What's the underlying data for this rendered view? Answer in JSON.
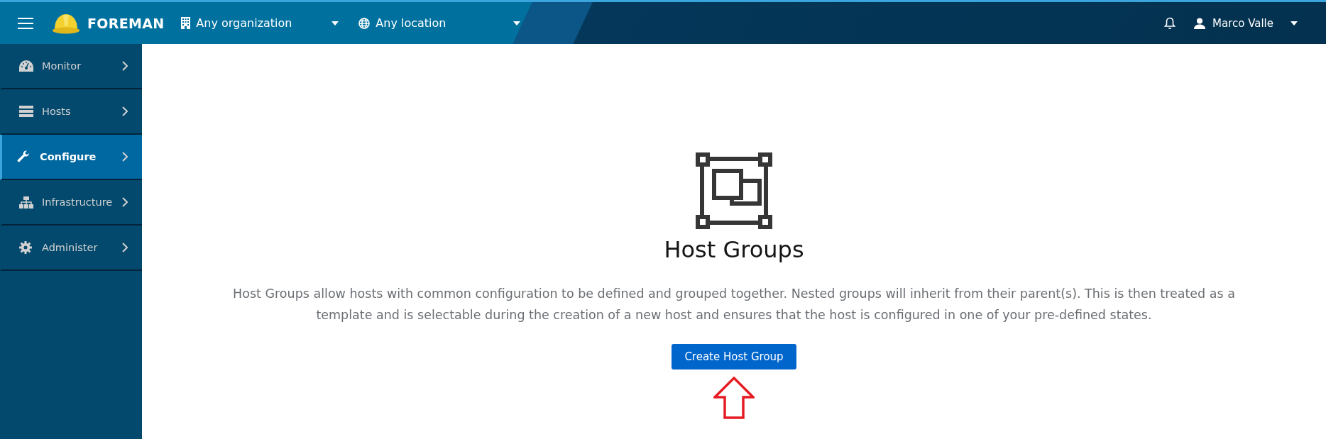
{
  "header": {
    "brand": "FOREMAN",
    "organization": "Any organization",
    "location": "Any location",
    "user": "Marco Valle"
  },
  "sidebar": {
    "items": [
      {
        "label": "Monitor",
        "selected": false
      },
      {
        "label": "Hosts",
        "selected": false
      },
      {
        "label": "Configure",
        "selected": true
      },
      {
        "label": "Infrastructure",
        "selected": false
      },
      {
        "label": "Administer",
        "selected": false
      }
    ]
  },
  "empty_state": {
    "title": "Host Groups",
    "description": "Host Groups allow hosts with common configuration to be defined and grouped together. Nested groups will inherit from their parent(s). This is then treated as a template and is selectable during the creation of a new host and ensures that the host is configured in one of your pre-defined states.",
    "button": "Create Host Group"
  }
}
